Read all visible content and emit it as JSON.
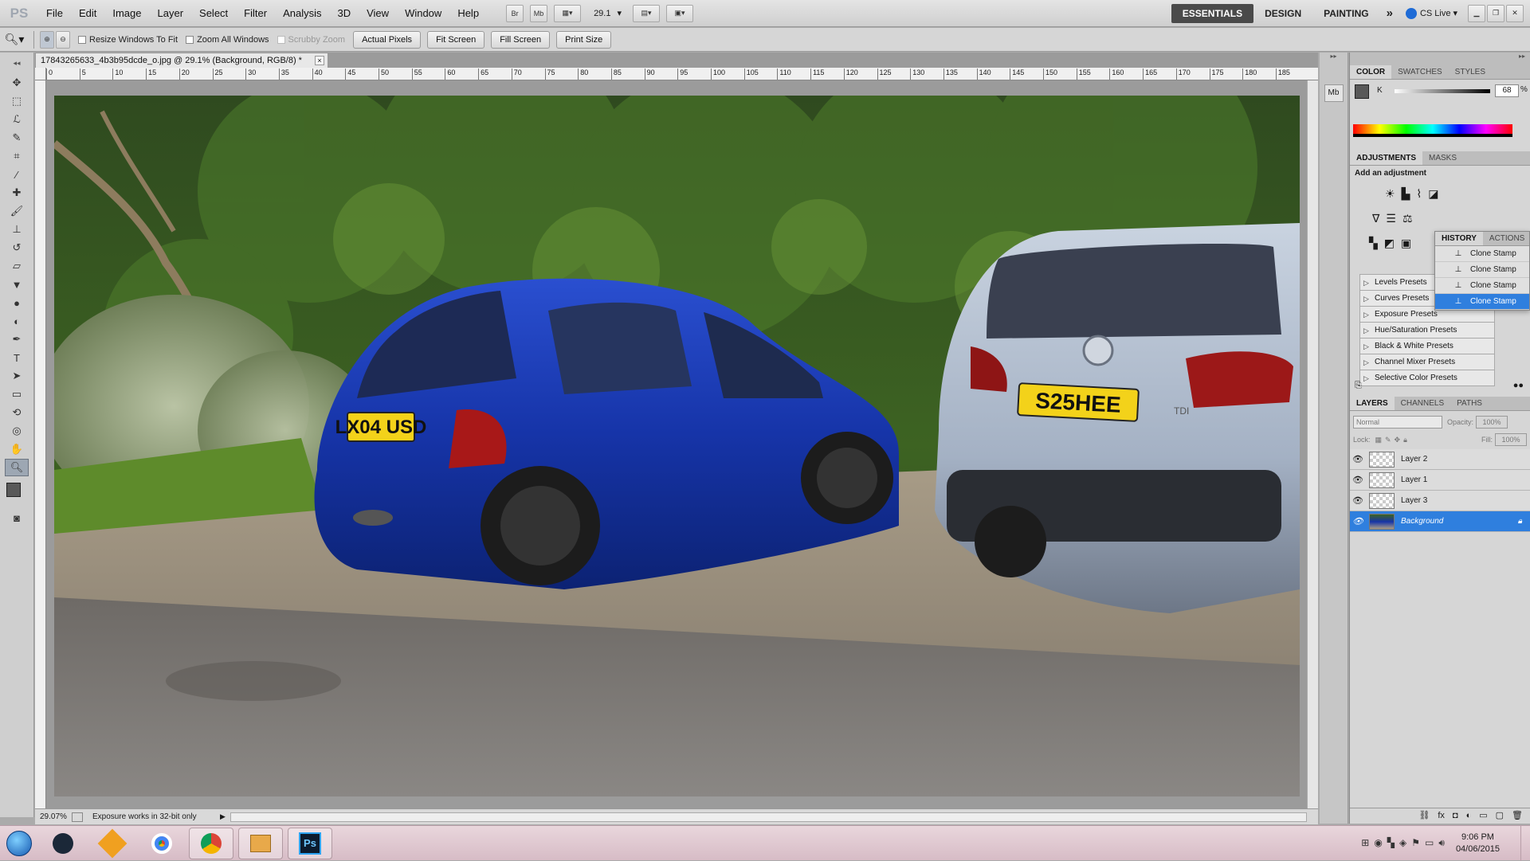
{
  "app": {
    "logo": "PS"
  },
  "menu": [
    "File",
    "Edit",
    "Image",
    "Layer",
    "Select",
    "Filter",
    "Analysis",
    "3D",
    "View",
    "Window",
    "Help"
  ],
  "menubar": {
    "bridge": "Br",
    "minibridge": "Mb",
    "zoom": "29.1",
    "workspaces": [
      "ESSENTIALS",
      "DESIGN",
      "PAINTING"
    ],
    "more": "»",
    "cslive": "CS Live"
  },
  "options": {
    "resize_windows": "Resize Windows To Fit",
    "zoom_all": "Zoom All Windows",
    "scrubby": "Scrubby Zoom",
    "buttons": [
      "Actual Pixels",
      "Fit Screen",
      "Fill Screen",
      "Print Size"
    ]
  },
  "document": {
    "tab_title": "17843265633_4b3b95dcde_o.jpg @ 29.1% (Background, RGB/8) *",
    "close": "×"
  },
  "ruler": {
    "labels": [
      "0",
      "5",
      "10",
      "15",
      "20",
      "25",
      "30",
      "35",
      "40",
      "45",
      "50",
      "55",
      "60",
      "65",
      "70",
      "75",
      "80",
      "85",
      "90",
      "95",
      "100",
      "105",
      "110",
      "115",
      "120",
      "125",
      "130",
      "135",
      "140",
      "145",
      "150",
      "155",
      "160",
      "165",
      "170",
      "175",
      "180",
      "185"
    ]
  },
  "image": {
    "plate_left": "LX04 USD",
    "plate_right": "S25HEE",
    "badge_tdi": "TDI"
  },
  "status": {
    "zoom": "29.07%",
    "message": "Exposure works in 32-bit only"
  },
  "color_panel": {
    "tabs": [
      "COLOR",
      "SWATCHES",
      "STYLES"
    ],
    "channel": "K",
    "value": "68",
    "unit": "%"
  },
  "adjustments": {
    "tabs": [
      "ADJUSTMENTS",
      "MASKS"
    ],
    "heading": "Add an adjustment",
    "presets": [
      "Levels Presets",
      "Curves Presets",
      "Exposure Presets",
      "Hue/Saturation Presets",
      "Black & White Presets",
      "Channel Mixer Presets",
      "Selective Color Presets"
    ]
  },
  "history": {
    "tabs": [
      "HISTORY",
      "ACTIONS"
    ],
    "items": [
      "Clone Stamp",
      "Clone Stamp",
      "Clone Stamp",
      "Clone Stamp"
    ]
  },
  "layers": {
    "tabs": [
      "LAYERS",
      "CHANNELS",
      "PATHS"
    ],
    "blend": "Normal",
    "opacity_label": "Opacity:",
    "opacity": "100%",
    "lock_label": "Lock:",
    "fill_label": "Fill:",
    "fill": "100%",
    "items": [
      "Layer 2",
      "Layer 1",
      "Layer 3",
      "Background"
    ]
  },
  "taskbar": {
    "time": "9:06 PM",
    "date": "04/06/2015",
    "ps_label": "Ps"
  }
}
